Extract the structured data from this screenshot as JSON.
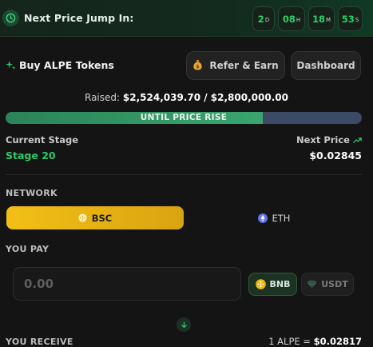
{
  "header": {
    "title": "Next Price Jump In:",
    "countdown": [
      {
        "value": "2",
        "unit": "D"
      },
      {
        "value": "08",
        "unit": "H"
      },
      {
        "value": "18",
        "unit": "M"
      },
      {
        "value": "53",
        "unit": "S"
      }
    ]
  },
  "buy": {
    "title": "Buy ALPE Tokens",
    "refer_label": "Refer & Earn",
    "dashboard_label": "Dashboard"
  },
  "raised": {
    "prefix": "Raised:",
    "amount": "$2,524,039.70 / $2,800,000.00"
  },
  "progress": {
    "label": "UNTIL PRICE RISE",
    "fraction": 0.7214
  },
  "stage": {
    "current_label": "Current Stage",
    "current_value": "Stage 20",
    "next_label": "Next Price",
    "next_value": "$0.02845"
  },
  "network": {
    "label": "NETWORK",
    "options": [
      {
        "name": "BSC",
        "selected": true
      },
      {
        "name": "ETH",
        "selected": false
      }
    ]
  },
  "pay": {
    "label": "YOU PAY",
    "placeholder": "0.00",
    "tokens": [
      "BNB",
      "USDT"
    ]
  },
  "receive": {
    "label": "YOU RECEIVE",
    "rate_prefix": "1 ALPE =",
    "rate_value": "$0.02817"
  },
  "colors": {
    "accent_green": "#2ccb6a",
    "accent_yellow": "#f3bf16"
  }
}
